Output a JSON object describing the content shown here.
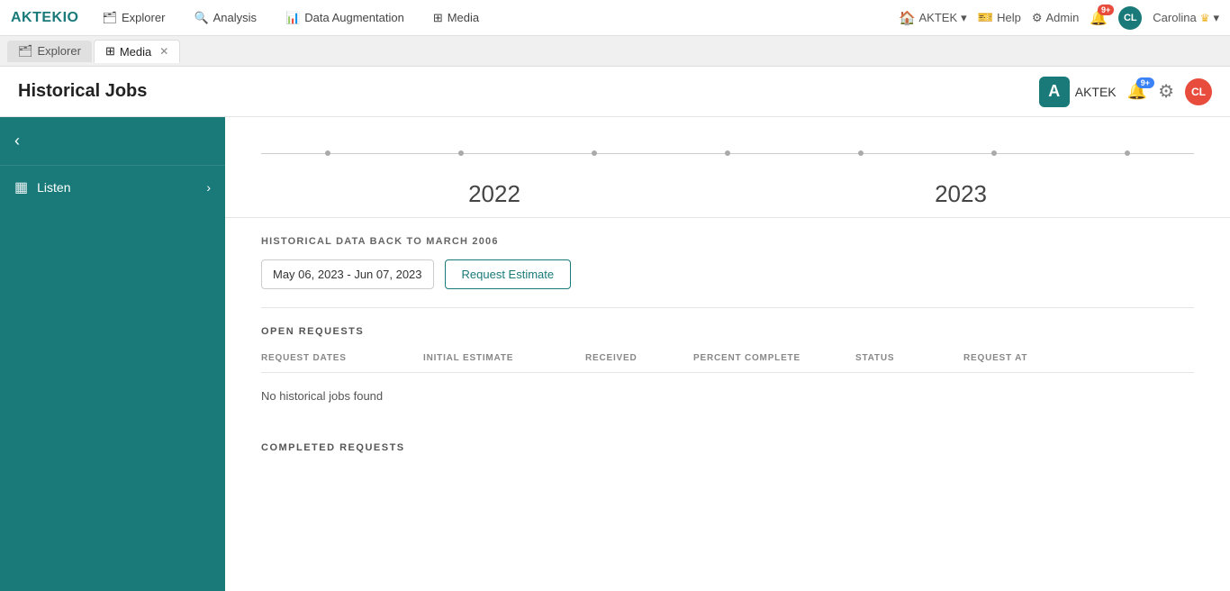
{
  "nav": {
    "logo": "AKTEKIO",
    "items": [
      {
        "label": "Explorer",
        "icon": "🗂"
      },
      {
        "label": "Analysis",
        "icon": "🔍"
      },
      {
        "label": "Data Augmentation",
        "icon": "📊"
      },
      {
        "label": "Media",
        "icon": "⊞"
      }
    ],
    "right": {
      "aktek_label": "AKTEK",
      "help_label": "Help",
      "admin_label": "Admin",
      "notification_count": "9+",
      "user_name": "Carolina"
    }
  },
  "tabs": [
    {
      "label": "Explorer",
      "icon": "🗂",
      "active": false,
      "closable": false
    },
    {
      "label": "Media",
      "icon": "⊞",
      "active": true,
      "closable": true
    }
  ],
  "page": {
    "title": "Historical Jobs",
    "aktek_badge": "A",
    "aktek_label": "AKTEK",
    "notification_count": "9+",
    "user_initials": "CL"
  },
  "sidebar": {
    "back_label": "‹",
    "items": [
      {
        "label": "Listen",
        "icon": "▦"
      }
    ]
  },
  "timeline": {
    "years": [
      "2022",
      "2023"
    ],
    "dots": [
      "·",
      "·",
      "·",
      "·",
      "·"
    ]
  },
  "historical": {
    "label": "HISTORICAL DATA BACK TO MARCH 2006",
    "date_range": "May 06, 2023 - Jun 07, 2023",
    "request_btn": "Request Estimate"
  },
  "open_requests": {
    "title": "OPEN REQUESTS",
    "columns": [
      "REQUEST DATES",
      "INITIAL ESTIMATE",
      "RECEIVED",
      "PERCENT COMPLETE",
      "STATUS",
      "REQUEST AT"
    ],
    "empty_message": "No historical jobs found"
  },
  "completed_requests": {
    "title": "COMPLETED REQUESTS"
  }
}
